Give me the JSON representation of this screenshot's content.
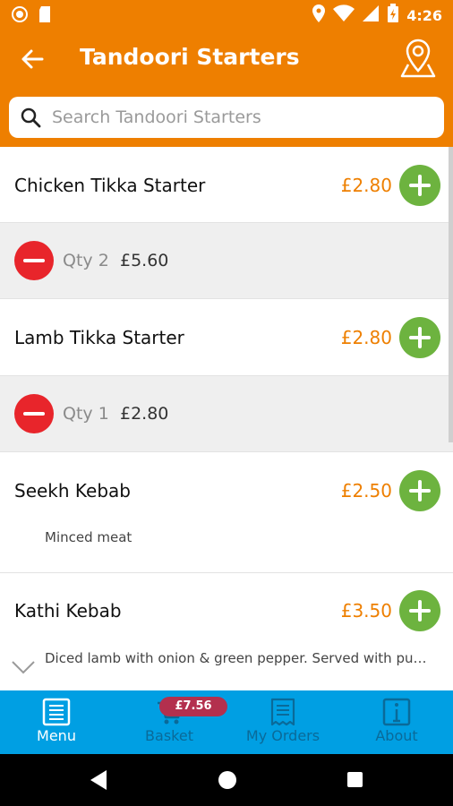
{
  "status_bar": {
    "time": "4:26",
    "icons": [
      "record-icon",
      "sd-card-icon",
      "location-icon",
      "wifi-icon",
      "signal-icon",
      "battery-icon"
    ]
  },
  "header": {
    "title": "Tandoori Starters",
    "back_icon": "arrow-left-icon",
    "map_icon": "map-pin-icon"
  },
  "search": {
    "placeholder": "Search Tandoori Starters",
    "value": ""
  },
  "items": [
    {
      "name": "Chicken Tikka Starter",
      "price": "£2.80",
      "qty_label": "Qty 2",
      "qty_total": "£5.60"
    },
    {
      "name": "Lamb Tikka Starter",
      "price": "£2.80",
      "qty_label": "Qty 1",
      "qty_total": "£2.80"
    },
    {
      "name": "Seekh Kebab",
      "price": "£2.50",
      "description": "Minced meat"
    },
    {
      "name": "Kathi Kebab",
      "price": "£3.50",
      "description": "Diced lamb with onion & green pepper. Served with pu…"
    }
  ],
  "bottom_nav": {
    "tabs": [
      {
        "label": "Menu",
        "icon": "menu-book-icon",
        "active": true
      },
      {
        "label": "Basket",
        "icon": "basket-icon",
        "active": false
      },
      {
        "label": "My Orders",
        "icon": "receipt-icon",
        "active": false
      },
      {
        "label": "About",
        "icon": "info-icon",
        "active": false
      }
    ],
    "basket_badge": "£7.56"
  },
  "colors": {
    "brand_orange": "#ee7f00",
    "add_green": "#6db33f",
    "remove_red": "#e8252b",
    "nav_blue": "#009fe3",
    "badge_maroon": "#b3304e"
  }
}
